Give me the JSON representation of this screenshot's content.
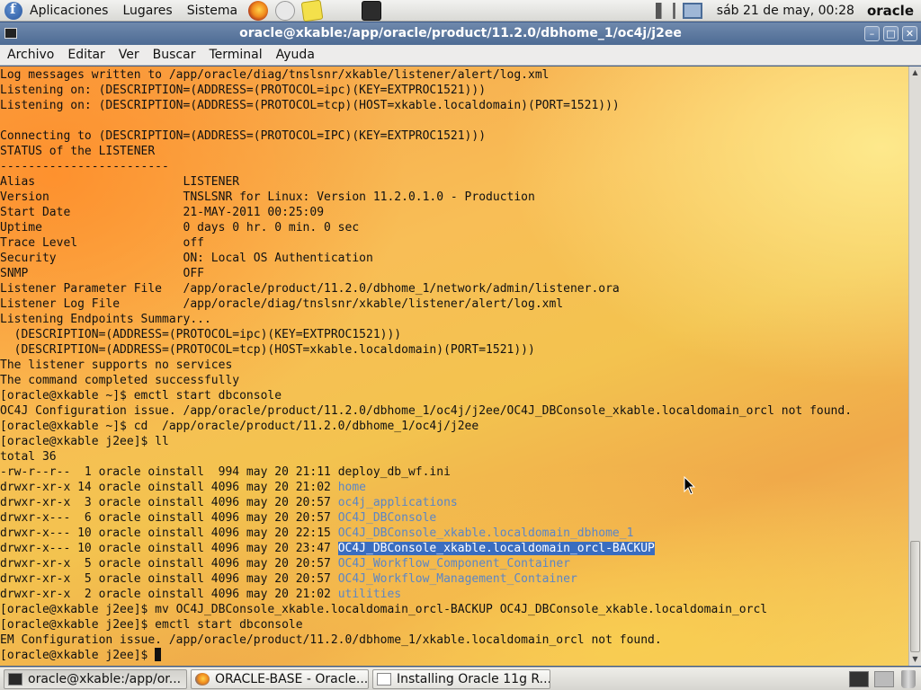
{
  "top_panel": {
    "menus": [
      "Aplicaciones",
      "Lugares",
      "Sistema"
    ],
    "clock": "sáb 21 de may, 00:28",
    "user": "oracle"
  },
  "window": {
    "title": "oracle@xkable:/app/oracle/product/11.2.0/dbhome_1/oc4j/j2ee"
  },
  "menubar": [
    "Archivo",
    "Editar",
    "Ver",
    "Buscar",
    "Terminal",
    "Ayuda"
  ],
  "terminal": {
    "lines": [
      {
        "text": "Log messages written to /app/oracle/diag/tnslsnr/xkable/listener/alert/log.xml"
      },
      {
        "text": "Listening on: (DESCRIPTION=(ADDRESS=(PROTOCOL=ipc)(KEY=EXTPROC1521)))"
      },
      {
        "text": "Listening on: (DESCRIPTION=(ADDRESS=(PROTOCOL=tcp)(HOST=xkable.localdomain)(PORT=1521)))"
      },
      {
        "text": ""
      },
      {
        "text": "Connecting to (DESCRIPTION=(ADDRESS=(PROTOCOL=IPC)(KEY=EXTPROC1521)))"
      },
      {
        "text": "STATUS of the LISTENER"
      },
      {
        "text": "------------------------"
      },
      {
        "text": "Alias                     LISTENER"
      },
      {
        "text": "Version                   TNSLSNR for Linux: Version 11.2.0.1.0 - Production"
      },
      {
        "text": "Start Date                21-MAY-2011 00:25:09"
      },
      {
        "text": "Uptime                    0 days 0 hr. 0 min. 0 sec"
      },
      {
        "text": "Trace Level               off"
      },
      {
        "text": "Security                  ON: Local OS Authentication"
      },
      {
        "text": "SNMP                      OFF"
      },
      {
        "text": "Listener Parameter File   /app/oracle/product/11.2.0/dbhome_1/network/admin/listener.ora"
      },
      {
        "text": "Listener Log File         /app/oracle/diag/tnslsnr/xkable/listener/alert/log.xml"
      },
      {
        "text": "Listening Endpoints Summary..."
      },
      {
        "text": "  (DESCRIPTION=(ADDRESS=(PROTOCOL=ipc)(KEY=EXTPROC1521)))"
      },
      {
        "text": "  (DESCRIPTION=(ADDRESS=(PROTOCOL=tcp)(HOST=xkable.localdomain)(PORT=1521)))"
      },
      {
        "text": "The listener supports no services"
      },
      {
        "text": "The command completed successfully"
      },
      {
        "text": "[oracle@xkable ~]$ emctl start dbconsole"
      },
      {
        "text": "OC4J Configuration issue. /app/oracle/product/11.2.0/dbhome_1/oc4j/j2ee/OC4J_DBConsole_xkable.localdomain_orcl not found."
      },
      {
        "text": "[oracle@xkable ~]$ cd  /app/oracle/product/11.2.0/dbhome_1/oc4j/j2ee"
      },
      {
        "text": "[oracle@xkable j2ee]$ ll"
      },
      {
        "text": "total 36"
      },
      {
        "text": "-rw-r--r--  1 oracle oinstall  994 may 20 21:11 ",
        "name": "deploy_db_wf.ini",
        "style": "plain"
      },
      {
        "text": "drwxr-xr-x 14 oracle oinstall 4096 may 20 21:02 ",
        "name": "home",
        "style": "dir"
      },
      {
        "text": "drwxr-xr-x  3 oracle oinstall 4096 may 20 20:57 ",
        "name": "oc4j_applications",
        "style": "dir"
      },
      {
        "text": "drwxr-x---  6 oracle oinstall 4096 may 20 20:57 ",
        "name": "OC4J_DBConsole",
        "style": "dir"
      },
      {
        "text": "drwxr-x--- 10 oracle oinstall 4096 may 20 22:15 ",
        "name": "OC4J_DBConsole_xkable.localdomain_dbhome_1",
        "style": "dir"
      },
      {
        "text": "drwxr-x--- 10 oracle oinstall 4096 may 20 23:47 ",
        "name": "OC4J_DBConsole_xkable.localdomain_orcl-BACKUP",
        "style": "hl"
      },
      {
        "text": "drwxr-xr-x  5 oracle oinstall 4096 may 20 20:57 ",
        "name": "OC4J_Workflow_Component_Container",
        "style": "dir"
      },
      {
        "text": "drwxr-xr-x  5 oracle oinstall 4096 may 20 20:57 ",
        "name": "OC4J_Workflow_Management_Container",
        "style": "dir"
      },
      {
        "text": "drwxr-xr-x  2 oracle oinstall 4096 may 20 21:02 ",
        "name": "utilities",
        "style": "dir"
      },
      {
        "text": "[oracle@xkable j2ee]$ mv OC4J_DBConsole_xkable.localdomain_orcl-BACKUP OC4J_DBConsole_xkable.localdomain_orcl"
      },
      {
        "text": "[oracle@xkable j2ee]$ emctl start dbconsole"
      },
      {
        "text": "EM Configuration issue. /app/oracle/product/11.2.0/dbhome_1/xkable.localdomain_orcl not found."
      },
      {
        "text": "[oracle@xkable j2ee]$ ",
        "cursor": true
      }
    ]
  },
  "taskbar": [
    {
      "label": "oracle@xkable:/app/or...",
      "icon": "terminal-icon",
      "active": true
    },
    {
      "label": "ORACLE-BASE - Oracle...",
      "icon": "firefox-icon",
      "active": false
    },
    {
      "label": "Installing Oracle 11g R...",
      "icon": "document-icon",
      "active": false
    }
  ]
}
